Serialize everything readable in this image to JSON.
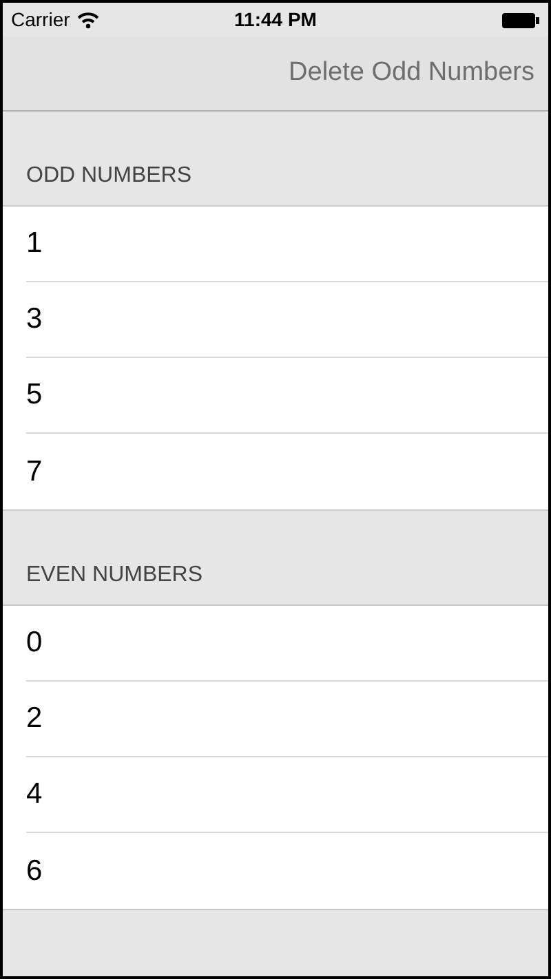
{
  "status_bar": {
    "carrier": "Carrier",
    "time": "11:44 PM"
  },
  "nav_bar": {
    "button": "Delete Odd Numbers"
  },
  "sections": [
    {
      "header": "ODD NUMBERS",
      "rows": [
        "1",
        "3",
        "5",
        "7"
      ]
    },
    {
      "header": "EVEN NUMBERS",
      "rows": [
        "0",
        "2",
        "4",
        "6"
      ]
    }
  ]
}
